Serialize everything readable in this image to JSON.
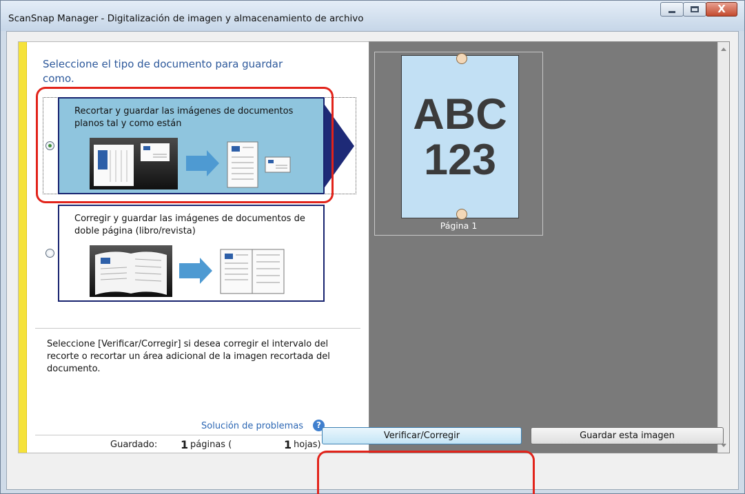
{
  "window": {
    "title": "ScanSnap Manager - Digitalización de imagen y almacenamiento de archivo",
    "controls": {
      "minimize_icon": "minimize-icon",
      "maximize_icon": "maximize-icon",
      "close_icon": "close-icon",
      "close_glyph": "X"
    }
  },
  "left_pane": {
    "heading": "Seleccione el tipo de documento para guardar como.",
    "options": [
      {
        "label": "Recortar y guardar las imágenes de documentos planos tal y como están",
        "selected": true,
        "illustration": "flat-documents-crop-illustration"
      },
      {
        "label": "Corregir y guardar las imágenes de documentos de doble página (libro/revista)",
        "selected": false,
        "illustration": "book-pages-correct-illustration"
      }
    ],
    "help_text": "Seleccione [Verificar/Corregir] si desea corregir el intervalo del recorte o recortar un área adicional de la imagen recortada del documento.",
    "troubleshooting_link": "Solución de problemas",
    "help_icon_glyph": "?",
    "saved": {
      "label": "Guardado:",
      "pages_count": "1",
      "pages_label": "páginas (",
      "sheets_count": "1",
      "sheets_label": "hojas)"
    }
  },
  "preview": {
    "page_text_line1": "ABC",
    "page_text_line2": "123",
    "caption": "Página 1"
  },
  "buttons": {
    "verify": "Verificar/Corregir",
    "save": "Guardar esta imagen"
  },
  "colors": {
    "accent_blue": "#2b579a",
    "option_selected_bg": "#8fc5de",
    "option_border": "#17236f",
    "highlight_red": "#e2231a",
    "yellow_bar": "#f5e23a"
  }
}
